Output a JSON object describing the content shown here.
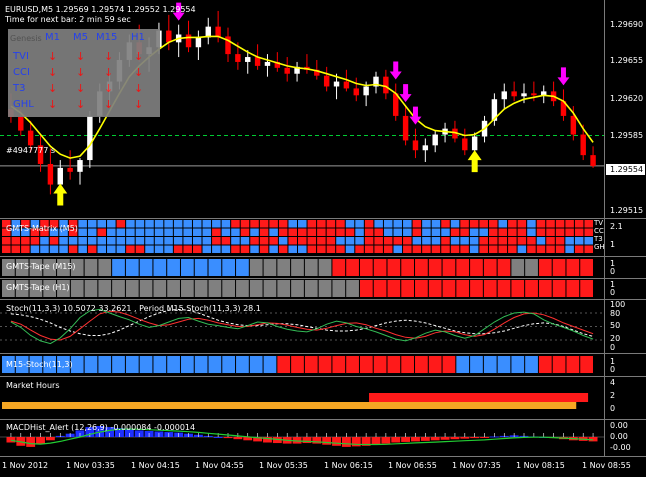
{
  "window": {
    "symbol_line": "EURUSD,M5  1.29569 1.29574 1.29552 1.29554",
    "timer_line": "Time for next bar: 2 min 59 sec",
    "order_label": "#4947777 s"
  },
  "genesis_table": {
    "corner": "Genesis",
    "columns": [
      "M1",
      "M5",
      "M15",
      "H1"
    ],
    "rows": [
      {
        "name": "TVI",
        "arrows": [
          "↓",
          "↓",
          "↓",
          "↓"
        ]
      },
      {
        "name": "CCI",
        "arrows": [
          "↓",
          "↓",
          "↓",
          "↓"
        ]
      },
      {
        "name": "T3",
        "arrows": [
          "↓",
          "↓",
          "↓",
          "↓"
        ]
      },
      {
        "name": "GHL",
        "arrows": [
          "↓",
          "↓",
          "↓",
          "↓"
        ]
      }
    ]
  },
  "panels": {
    "matrix_title": "GMTS-Matrix (M5)",
    "matrix_side_labels": [
      "TV",
      "CC",
      "T3",
      "GH"
    ],
    "matrix_scale": [
      "2.1",
      "1"
    ],
    "tape_m15_title": "GMTS-Tape (M15)",
    "tape_m15_scale": [
      "1",
      "0"
    ],
    "tape_h1_title": "GMTS-Tape (H1)",
    "tape_h1_scale": [
      "1",
      "0"
    ],
    "stoch_title": "Stoch(11,3,3) 10.5072 33.2621 , Period M15 Stoch(11,3,3) 28.1",
    "stoch_scale": [
      "100",
      "80",
      "50",
      "20",
      "0"
    ],
    "m15_stoch_title": "M15-Stoch(11,3)",
    "m15_stoch_scale": [
      "1",
      "0"
    ],
    "market_hours_title": "Market Hours",
    "market_hours_scale": [
      "4",
      "2",
      "0"
    ],
    "macd_title": "MACDHist_Alert (12,26,9) -0.000084 -0.000014",
    "macd_scale": [
      "0.00",
      "0.00",
      "-0.00"
    ]
  },
  "colors": {
    "background": "#000000",
    "bull": "#ffffff",
    "bear": "#ff0000",
    "ma": "#ffff00",
    "blue": "#3a8eff",
    "red": "#ff1a1a",
    "grey": "#808080",
    "orange": "#f5a623",
    "magenta": "#ff00ff",
    "level_line": "#00cc33"
  },
  "chart_data": {
    "type": "candlestick",
    "x_labels": [
      "1 Nov 2012",
      "1 Nov 03:35",
      "1 Nov 04:15",
      "1 Nov 04:55",
      "1 Nov 05:35",
      "1 Nov 06:15",
      "1 Nov 06:55",
      "1 Nov 07:35",
      "1 Nov 08:15",
      "1 Nov 08:55"
    ],
    "y_ticks": [
      "1.29690",
      "1.29655",
      "1.29620",
      "1.29585",
      "1.29554",
      "1.29515"
    ],
    "current_price": "1.29554",
    "ylim": [
      1.29505,
      1.29715
    ],
    "level_line_price": 1.29585,
    "ohlc": [
      [
        1.29612,
        1.29628,
        1.29598,
        1.29604
      ],
      [
        1.29604,
        1.29612,
        1.29585,
        1.2959
      ],
      [
        1.2959,
        1.296,
        1.29568,
        1.29575
      ],
      [
        1.29575,
        1.29585,
        1.29548,
        1.29556
      ],
      [
        1.29556,
        1.29572,
        1.29525,
        1.29535
      ],
      [
        1.29535,
        1.2956,
        1.29528,
        1.29552
      ],
      [
        1.29552,
        1.2957,
        1.2954,
        1.29548
      ],
      [
        1.29548,
        1.29562,
        1.29535,
        1.2956
      ],
      [
        1.2956,
        1.2961,
        1.29552,
        1.29605
      ],
      [
        1.29605,
        1.29638,
        1.29598,
        1.2963
      ],
      [
        1.2963,
        1.29648,
        1.29615,
        1.2964
      ],
      [
        1.2964,
        1.2967,
        1.29632,
        1.29662
      ],
      [
        1.29662,
        1.29688,
        1.29655,
        1.2968
      ],
      [
        1.2968,
        1.29698,
        1.2966,
        1.29668
      ],
      [
        1.29668,
        1.29685,
        1.2965,
        1.29675
      ],
      [
        1.29675,
        1.297,
        1.29668,
        1.29692
      ],
      [
        1.29692,
        1.29708,
        1.29672,
        1.2968
      ],
      [
        1.2968,
        1.29698,
        1.29665,
        1.29688
      ],
      [
        1.29688,
        1.29702,
        1.2967,
        1.29675
      ],
      [
        1.29675,
        1.29692,
        1.29662,
        1.29685
      ],
      [
        1.29685,
        1.29705,
        1.29678,
        1.29696
      ],
      [
        1.29696,
        1.29712,
        1.2968,
        1.29686
      ],
      [
        1.29686,
        1.29695,
        1.2966,
        1.29668
      ],
      [
        1.29668,
        1.2968,
        1.29652,
        1.2966
      ],
      [
        1.2966,
        1.29672,
        1.29648,
        1.29665
      ],
      [
        1.29665,
        1.29678,
        1.29652,
        1.29656
      ],
      [
        1.29656,
        1.29668,
        1.29645,
        1.2966
      ],
      [
        1.2966,
        1.2967,
        1.2965,
        1.29654
      ],
      [
        1.29654,
        1.29665,
        1.2964,
        1.29648
      ],
      [
        1.29648,
        1.2966,
        1.2964,
        1.29655
      ],
      [
        1.29655,
        1.29668,
        1.29648,
        1.29652
      ],
      [
        1.29652,
        1.29662,
        1.29642,
        1.29646
      ],
      [
        1.29646,
        1.29655,
        1.2963,
        1.29635
      ],
      [
        1.29635,
        1.29648,
        1.29622,
        1.2964
      ],
      [
        1.2964,
        1.29652,
        1.2963,
        1.29633
      ],
      [
        1.29633,
        1.29644,
        1.2962,
        1.29626
      ],
      [
        1.29626,
        1.2964,
        1.29615,
        1.29635
      ],
      [
        1.29635,
        1.2965,
        1.29628,
        1.29645
      ],
      [
        1.29645,
        1.29652,
        1.29622,
        1.29628
      ],
      [
        1.29628,
        1.29638,
        1.296,
        1.29605
      ],
      [
        1.29605,
        1.29615,
        1.29575,
        1.2958
      ],
      [
        1.2958,
        1.29592,
        1.29562,
        1.2957
      ],
      [
        1.2957,
        1.29582,
        1.29558,
        1.29575
      ],
      [
        1.29575,
        1.2959,
        1.29568,
        1.29586
      ],
      [
        1.29586,
        1.29598,
        1.29578,
        1.29592
      ],
      [
        1.29592,
        1.296,
        1.29578,
        1.29582
      ],
      [
        1.29582,
        1.29592,
        1.29565,
        1.2957
      ],
      [
        1.2957,
        1.29588,
        1.29562,
        1.29584
      ],
      [
        1.29584,
        1.29605,
        1.29578,
        1.296
      ],
      [
        1.296,
        1.29628,
        1.29595,
        1.29622
      ],
      [
        1.29622,
        1.29638,
        1.29612,
        1.2963
      ],
      [
        1.2963,
        1.2964,
        1.2962,
        1.29625
      ],
      [
        1.29625,
        1.29638,
        1.29618,
        1.29628
      ],
      [
        1.29628,
        1.2964,
        1.2962,
        1.29626
      ],
      [
        1.29626,
        1.29636,
        1.29618,
        1.2963
      ],
      [
        1.2963,
        1.2964,
        1.29615,
        1.2962
      ],
      [
        1.2962,
        1.29632,
        1.296,
        1.29605
      ],
      [
        1.29605,
        1.29615,
        1.2958,
        1.29586
      ],
      [
        1.29586,
        1.29596,
        1.2956,
        1.29565
      ],
      [
        1.29565,
        1.29574,
        1.29552,
        1.29554
      ]
    ],
    "ma_values": [
      1.29615,
      1.29608,
      1.29598,
      1.29586,
      1.29574,
      1.29566,
      1.29562,
      1.29564,
      1.29575,
      1.29592,
      1.2961,
      1.29628,
      1.29645,
      1.29656,
      1.29665,
      1.29673,
      1.2968,
      1.29684,
      1.29685,
      1.29685,
      1.29686,
      1.29686,
      1.29682,
      1.29676,
      1.2967,
      1.29665,
      1.29662,
      1.29659,
      1.29656,
      1.29654,
      1.29653,
      1.29651,
      1.29648,
      1.29645,
      1.29642,
      1.29638,
      1.29636,
      1.29637,
      1.29635,
      1.29628,
      1.29615,
      1.29602,
      1.29594,
      1.2959,
      1.29589,
      1.29588,
      1.29585,
      1.29586,
      1.29592,
      1.29602,
      1.29612,
      1.29618,
      1.29622,
      1.29624,
      1.29626,
      1.29625,
      1.2962,
      1.29608,
      1.29592,
      1.29578
    ],
    "signal_arrows": [
      {
        "bar": 5,
        "dir": "up",
        "color": "#ffff00"
      },
      {
        "bar": 17,
        "dir": "down",
        "color": "#ff00ff"
      },
      {
        "bar": 39,
        "dir": "down",
        "color": "#ff00ff"
      },
      {
        "bar": 40,
        "dir": "down",
        "color": "#ff00ff"
      },
      {
        "bar": 41,
        "dir": "down",
        "color": "#ff00ff"
      },
      {
        "bar": 47,
        "dir": "up",
        "color": "#ffff00"
      },
      {
        "bar": 56,
        "dir": "down",
        "color": "#ff00ff"
      }
    ],
    "tape_m15": [
      "grey",
      "grey",
      "grey",
      "grey",
      "grey",
      "grey",
      "grey",
      "grey",
      "blue",
      "blue",
      "blue",
      "blue",
      "blue",
      "blue",
      "blue",
      "blue",
      "blue",
      "blue",
      "grey",
      "grey",
      "grey",
      "grey",
      "grey",
      "grey",
      "red",
      "red",
      "red",
      "red",
      "red",
      "red",
      "red",
      "red",
      "red",
      "red",
      "red",
      "red",
      "red",
      "grey",
      "grey",
      "red",
      "red",
      "red",
      "red"
    ],
    "tape_h1": [
      "grey",
      "grey",
      "grey",
      "grey",
      "grey",
      "grey",
      "grey",
      "grey",
      "grey",
      "grey",
      "grey",
      "grey",
      "grey",
      "grey",
      "grey",
      "grey",
      "grey",
      "grey",
      "grey",
      "grey",
      "grey",
      "grey",
      "grey",
      "grey",
      "grey",
      "grey",
      "red",
      "red",
      "red",
      "red",
      "red",
      "red",
      "red",
      "red",
      "red",
      "red",
      "red",
      "red",
      "red",
      "red",
      "red",
      "red",
      "red"
    ],
    "m15_stoch": [
      "blue",
      "blue",
      "blue",
      "blue",
      "blue",
      "blue",
      "blue",
      "blue",
      "blue",
      "blue",
      "blue",
      "blue",
      "blue",
      "blue",
      "blue",
      "blue",
      "blue",
      "blue",
      "blue",
      "blue",
      "red",
      "red",
      "red",
      "red",
      "red",
      "red",
      "red",
      "red",
      "red",
      "red",
      "red",
      "red",
      "red",
      "blue",
      "blue",
      "blue",
      "blue",
      "blue",
      "blue",
      "red",
      "red",
      "red",
      "red"
    ],
    "stoch_k": [
      60,
      48,
      30,
      18,
      12,
      25,
      45,
      70,
      85,
      88,
      80,
      72,
      65,
      55,
      48,
      52,
      60,
      68,
      70,
      62,
      55,
      52,
      48,
      45,
      52,
      60,
      58,
      50,
      44,
      40,
      38,
      45,
      55,
      62,
      58,
      50,
      45,
      38,
      30,
      22,
      18,
      25,
      35,
      42,
      38,
      30,
      24,
      30,
      45,
      60,
      72,
      80,
      82,
      78,
      65,
      55,
      48,
      40,
      30,
      22
    ],
    "stoch_d": [
      62,
      55,
      42,
      30,
      22,
      20,
      28,
      45,
      62,
      78,
      84,
      82,
      75,
      66,
      58,
      52,
      54,
      60,
      66,
      68,
      64,
      58,
      54,
      50,
      50,
      54,
      58,
      57,
      53,
      48,
      44,
      42,
      46,
      52,
      57,
      58,
      54,
      46,
      40,
      32,
      26,
      24,
      28,
      36,
      40,
      38,
      32,
      28,
      32,
      44,
      58,
      70,
      78,
      80,
      76,
      68,
      58,
      50,
      42,
      34
    ],
    "stoch_m15": [
      78,
      76,
      72,
      66,
      58,
      48,
      40,
      34,
      30,
      30,
      34,
      42,
      52,
      62,
      72,
      80,
      86,
      88,
      86,
      80,
      72,
      64,
      58,
      54,
      52,
      52,
      54,
      56,
      56,
      54,
      50,
      46,
      42,
      40,
      40,
      42,
      46,
      52,
      58,
      62,
      64,
      62,
      58,
      52,
      46,
      40,
      36,
      34,
      34,
      36,
      40,
      46,
      52,
      56,
      58,
      56,
      50,
      42,
      34,
      28
    ],
    "market_hours_red": [
      0.62,
      0.99
    ],
    "market_hours_orange": [
      0.0,
      0.97
    ],
    "macd_hist": [
      -0.5,
      -0.8,
      -0.9,
      -0.6,
      -0.3,
      0.1,
      0.3,
      0.6,
      0.9,
      1.0,
      0.9,
      0.8,
      0.7,
      0.6,
      0.55,
      0.5,
      0.45,
      0.4,
      0.3,
      0.2,
      0.1,
      0.0,
      -0.1,
      -0.2,
      -0.3,
      -0.4,
      -0.5,
      -0.55,
      -0.6,
      -0.6,
      -0.55,
      -0.6,
      -0.7,
      -0.8,
      -0.9,
      -0.85,
      -0.8,
      -0.7,
      -0.6,
      -0.5,
      -0.45,
      -0.4,
      -0.35,
      -0.3,
      -0.25,
      -0.2,
      -0.15,
      -0.1,
      -0.05,
      0.05,
      0.1,
      0.15,
      0.1,
      0.05,
      0.0,
      -0.1,
      -0.2,
      -0.3,
      -0.35,
      -0.4
    ],
    "macd_signal": [
      -0.3,
      -0.45,
      -0.6,
      -0.65,
      -0.55,
      -0.4,
      -0.2,
      0.0,
      0.25,
      0.45,
      0.6,
      0.7,
      0.72,
      0.7,
      0.66,
      0.62,
      0.58,
      0.54,
      0.48,
      0.42,
      0.34,
      0.26,
      0.18,
      0.1,
      0.02,
      -0.06,
      -0.14,
      -0.22,
      -0.3,
      -0.36,
      -0.4,
      -0.44,
      -0.5,
      -0.56,
      -0.62,
      -0.66,
      -0.68,
      -0.68,
      -0.66,
      -0.62,
      -0.58,
      -0.54,
      -0.5,
      -0.46,
      -0.42,
      -0.38,
      -0.34,
      -0.3,
      -0.26,
      -0.2,
      -0.14,
      -0.08,
      -0.04,
      -0.02,
      -0.02,
      -0.05,
      -0.1,
      -0.15,
      -0.2,
      -0.25
    ]
  }
}
